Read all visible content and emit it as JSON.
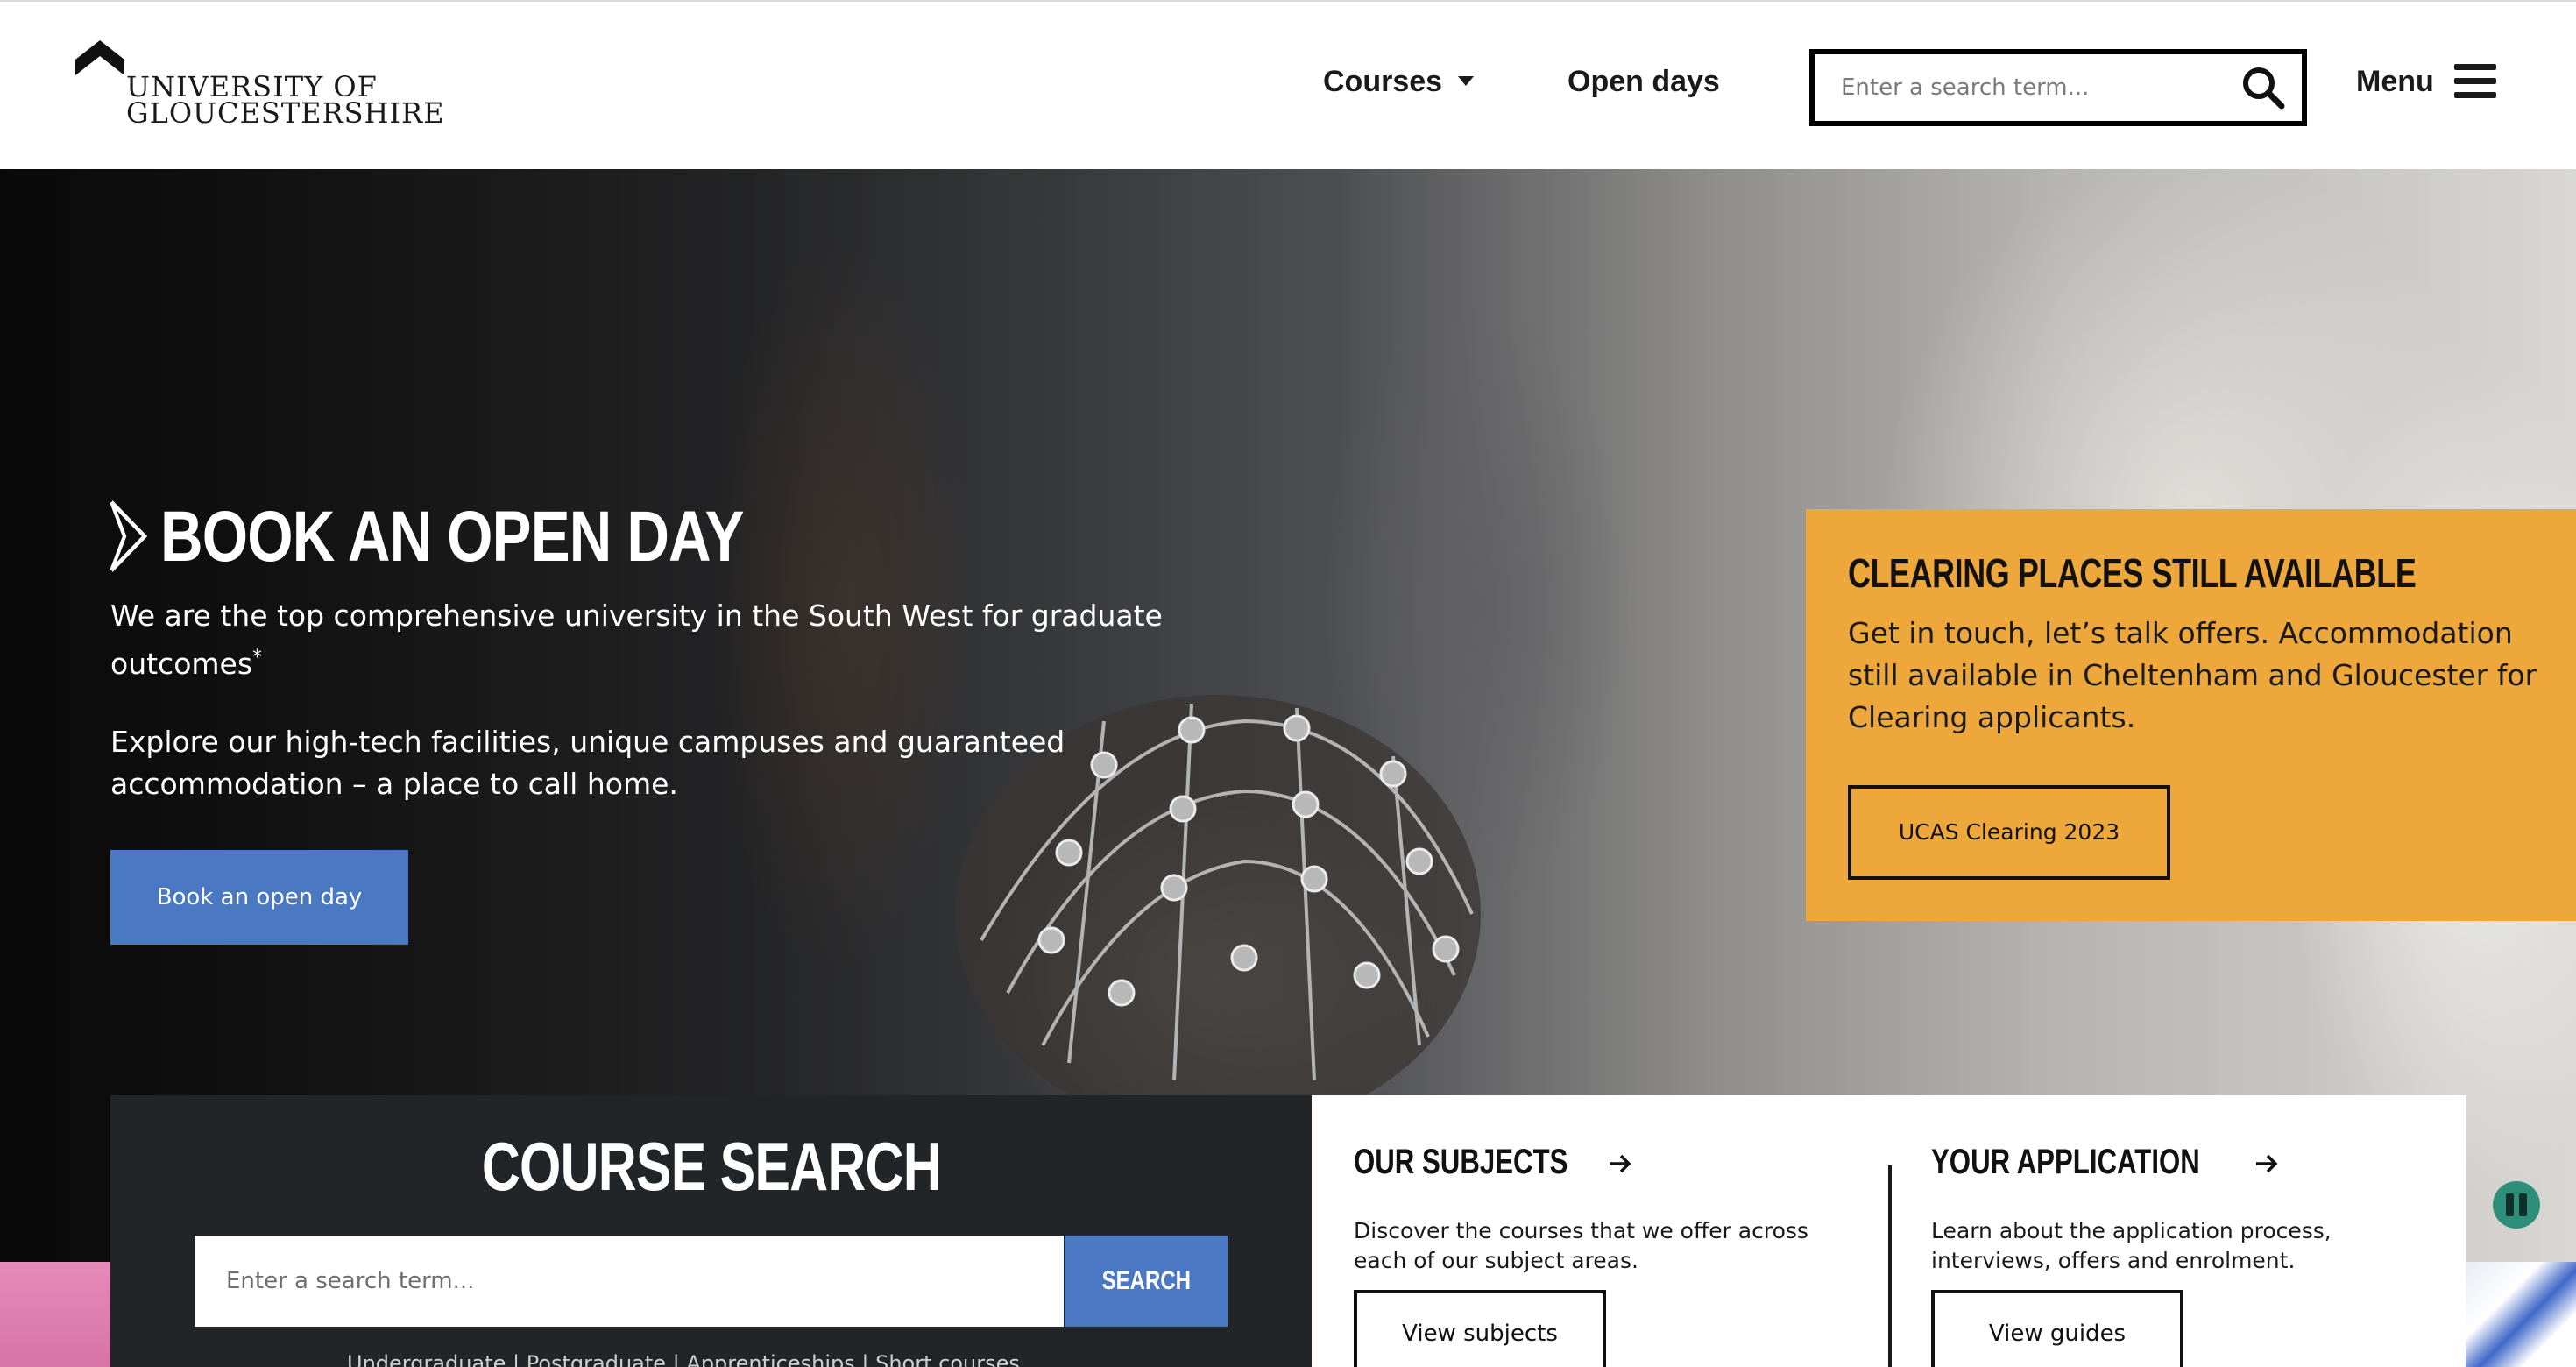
{
  "header": {
    "logo": {
      "line1": "UNIVERSITY OF",
      "line2": "GLOUCESTERSHIRE"
    },
    "nav": {
      "courses_label": "Courses",
      "open_days_label": "Open days"
    },
    "search": {
      "placeholder": "Enter a search term..."
    },
    "menu_label": "Menu"
  },
  "hero": {
    "title": "BOOK AN OPEN DAY",
    "subtitle": "We are the top comprehensive university in the South West for graduate outcomes",
    "subtitle_mark": "*",
    "body": "Explore our high-tech facilities, unique campuses and guaranteed accommodation – a place to call home.",
    "button_label": "Book an open day"
  },
  "clearing": {
    "title": "CLEARING PLACES STILL AVAILABLE",
    "text": "Get in touch, let’s talk offers. Accommodation still available in Cheltenham and Gloucester for Clearing applicants.",
    "button_label": "UCAS Clearing 2023",
    "color": "#eda73a"
  },
  "course_search": {
    "title": "COURSE SEARCH",
    "placeholder": "Enter a search term...",
    "button_label": "SEARCH",
    "links": "Undergraduate | Postgraduate | Apprenticeships | Short courses"
  },
  "subjects": {
    "title": "OUR SUBJECTS",
    "text": "Discover the courses that we offer across each of our subject areas.",
    "button_label": "View subjects"
  },
  "application": {
    "title": "YOUR APPLICATION",
    "text": "Learn about the application process, interviews, offers and enrolment.",
    "button_label": "View guides"
  },
  "colors": {
    "accent_blue": "#4a78c2",
    "clearing_orange": "#eda73a",
    "panel_dark": "#222527",
    "pause_green": "#2d8f7a"
  },
  "icons": [
    "logo-chevron-icon",
    "chevron-down-icon",
    "search-icon",
    "hamburger-menu-icon",
    "title-chevron-icon",
    "arrow-right-icon",
    "pause-icon"
  ]
}
